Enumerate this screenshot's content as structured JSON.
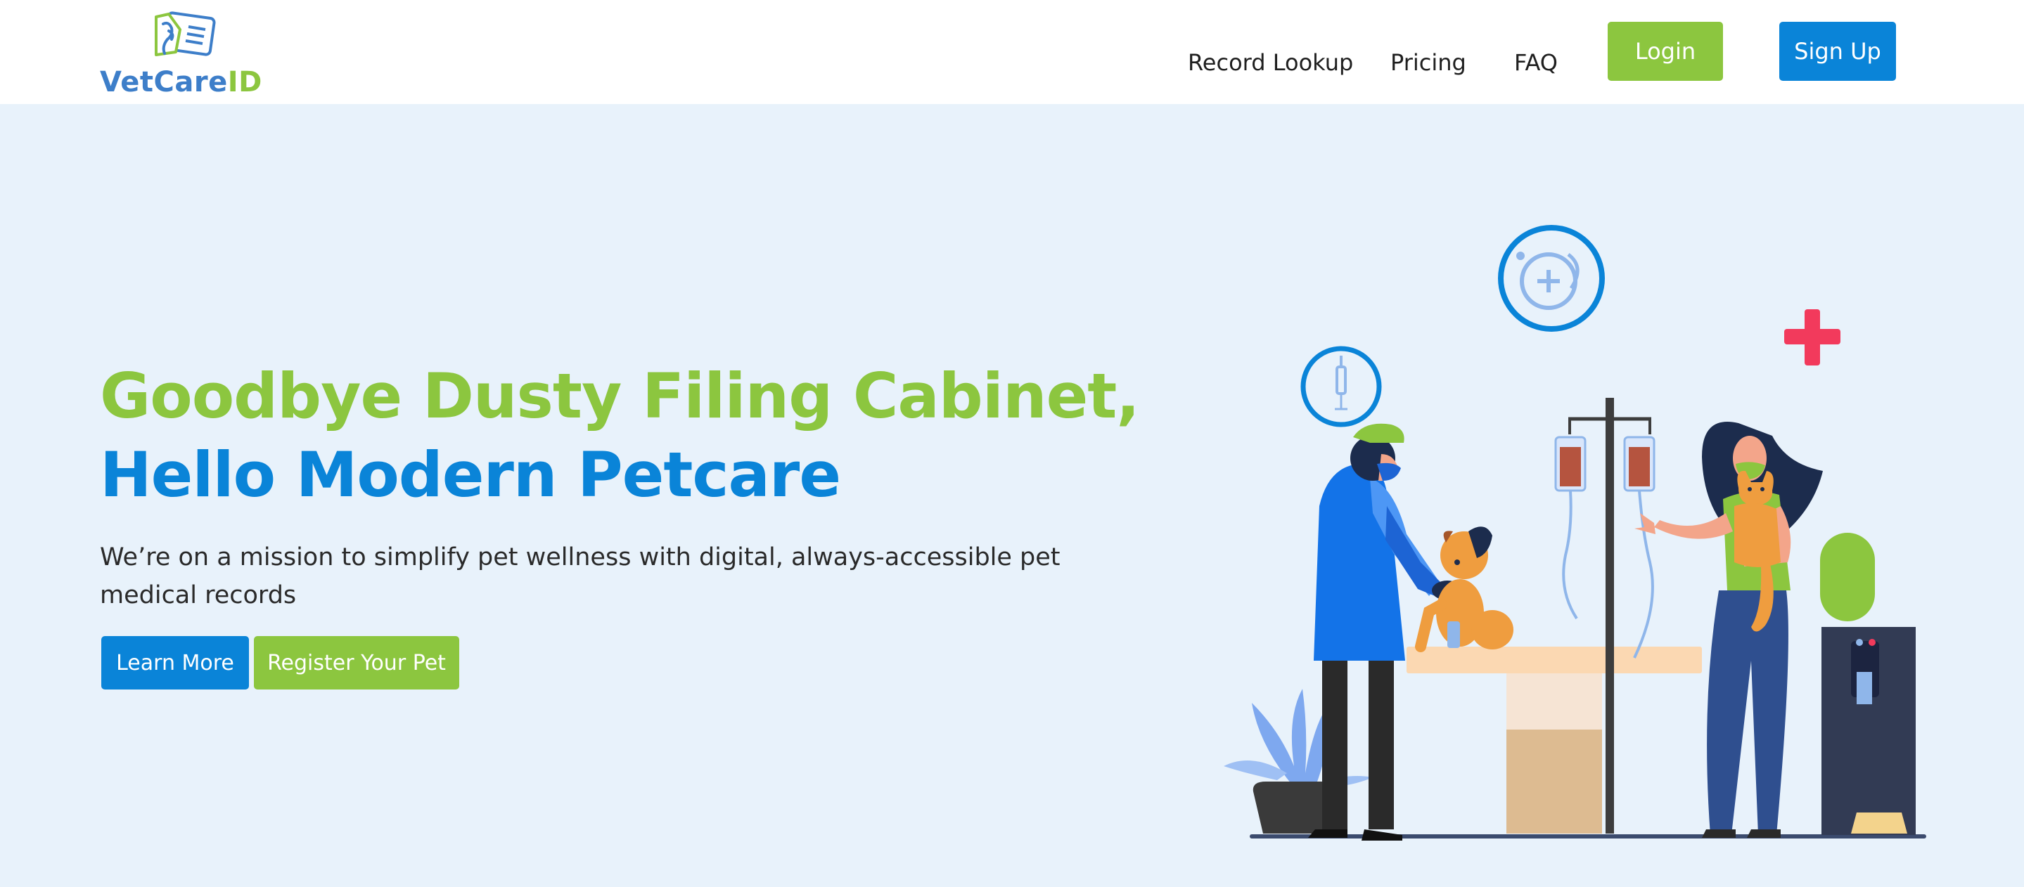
{
  "brand": {
    "name_part1": "VetCare",
    "name_part2": "ID",
    "primary_color": "#0a84d8",
    "accent_color": "#8cc63f",
    "logo_icon": "pet-id-card-icon"
  },
  "nav": {
    "links": [
      {
        "label": "Record Lookup"
      },
      {
        "label": "Pricing"
      },
      {
        "label": "FAQ"
      }
    ],
    "login_label": "Login",
    "signup_label": "Sign Up"
  },
  "hero": {
    "headline_line1": "Goodbye Dusty Filing Cabinet,",
    "headline_line2": "Hello Modern Petcare",
    "subtext": "We’re on a mission to simplify pet wellness with digital, always-accessible pet medical records",
    "primary_cta": "Learn More",
    "secondary_cta": "Register Your Pet"
  },
  "illustration": {
    "subject": "veterinary-clinic-illustration",
    "icons": [
      "syringe-icon",
      "stethoscope-icon",
      "medical-cross-icon"
    ]
  }
}
